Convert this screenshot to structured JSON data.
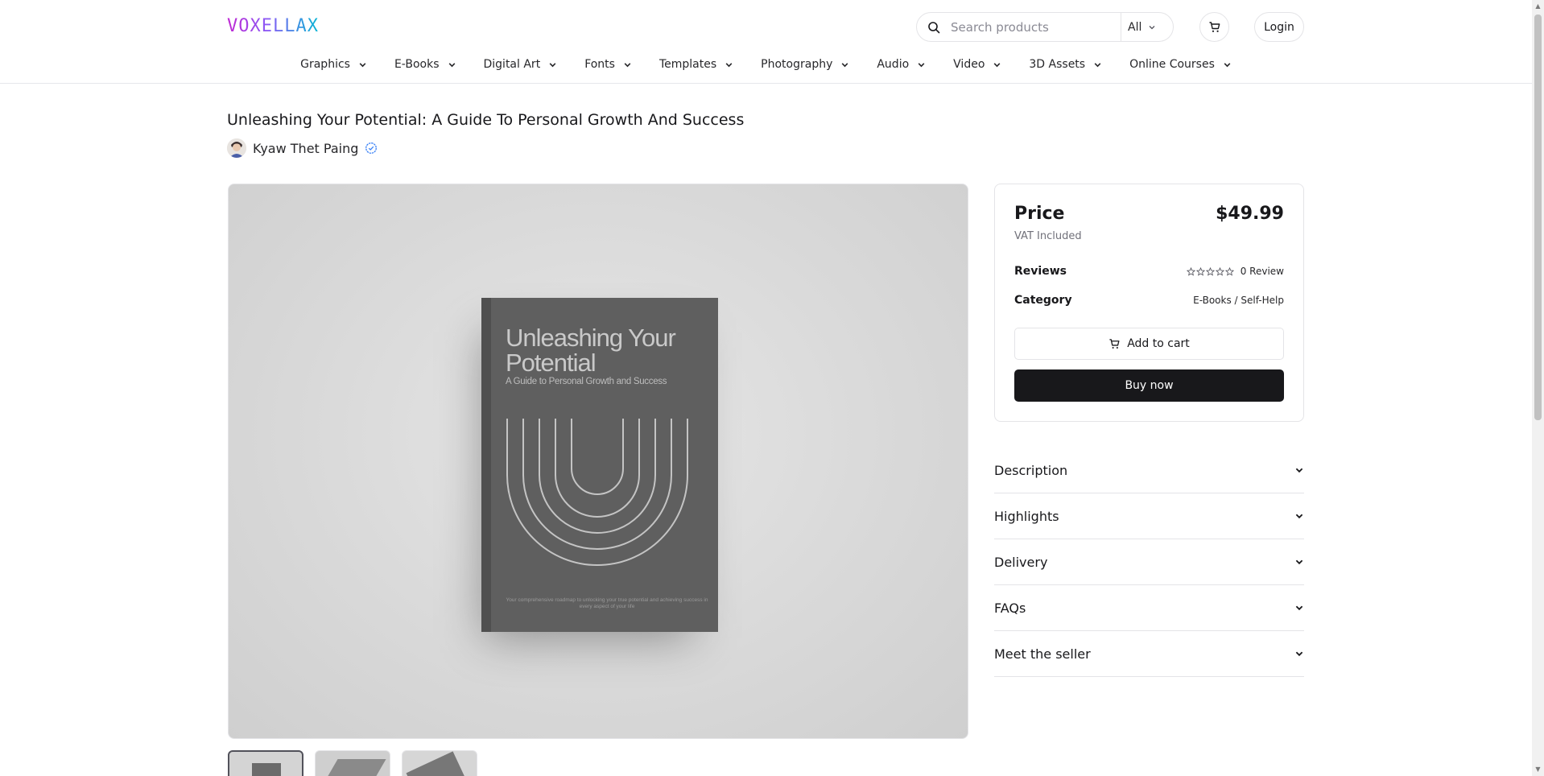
{
  "header": {
    "logo": "VOXELLAX",
    "search": {
      "placeholder": "Search products",
      "scope": "All"
    },
    "login": "Login",
    "icons": {
      "search": "search-icon",
      "cart": "cart-icon",
      "chevron": "chevron-down-icon"
    }
  },
  "nav": {
    "items": [
      {
        "label": "Graphics"
      },
      {
        "label": "E-Books"
      },
      {
        "label": "Digital Art"
      },
      {
        "label": "Fonts"
      },
      {
        "label": "Templates"
      },
      {
        "label": "Photography"
      },
      {
        "label": "Audio"
      },
      {
        "label": "Video"
      },
      {
        "label": "3D Assets"
      },
      {
        "label": "Online Courses"
      }
    ]
  },
  "product": {
    "title": "Unleashing Your Potential: A Guide To Personal Growth And Success",
    "seller": "Kyaw Thet Paing",
    "seller_verified": true,
    "image": {
      "book_title": "Unleashing Your Potential",
      "book_subtitle": "A Guide to Personal Growth and Success",
      "book_footer": "Your comprehensive roadmap to unlocking your true potential and achieving success in every aspect of your life"
    },
    "thumbnail_count": 3,
    "active_thumbnail": 1
  },
  "pricing": {
    "price_label": "Price",
    "price": "$49.99",
    "vat": "VAT Included",
    "reviews_label": "Reviews",
    "rating": 0,
    "rating_max": 5,
    "reviews_count": "0 Review",
    "category_label": "Category",
    "category": "E-Books / Self-Help",
    "add_to_cart": "Add to cart",
    "buy_now": "Buy now"
  },
  "accordion": {
    "items": [
      {
        "label": "Description"
      },
      {
        "label": "Highlights"
      },
      {
        "label": "Delivery"
      },
      {
        "label": "FAQs"
      },
      {
        "label": "Meet the seller"
      }
    ]
  },
  "colors": {
    "primary": "#18181b",
    "border": "#e4e4e7",
    "verified": "#3b82f6",
    "logo_gradient": [
      "#c026d3",
      "#8b5cf6",
      "#06b6d4"
    ]
  }
}
